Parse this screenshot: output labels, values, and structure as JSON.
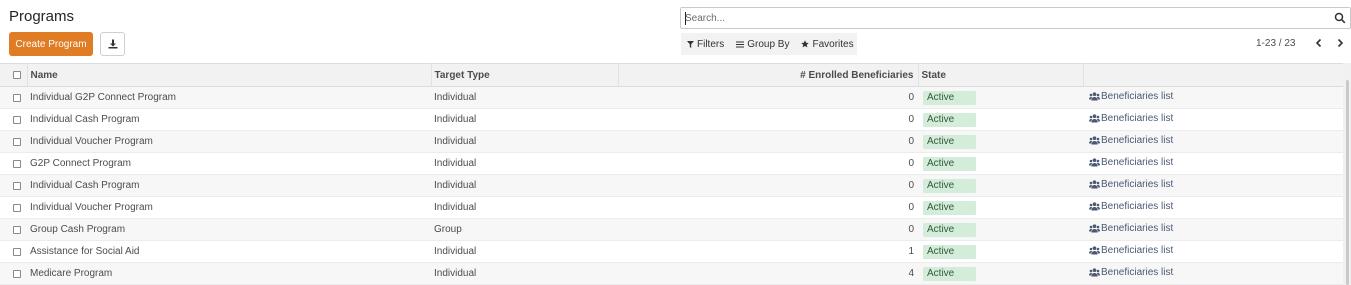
{
  "page": {
    "title": "Programs"
  },
  "toolbar": {
    "create_label": "Create Program",
    "download_icon": "download-icon"
  },
  "search": {
    "placeholder": "Search...",
    "value": ""
  },
  "filters": {
    "filters_label": "Filters",
    "group_by_label": "Group By",
    "favorites_label": "Favorites"
  },
  "pager": {
    "value": "1-23 / 23"
  },
  "table": {
    "headers": {
      "name": "Name",
      "target_type": "Target Type",
      "enrolled": "# Enrolled Beneficiaries",
      "state": "State"
    },
    "rows": [
      {
        "name": "Individual G2P Connect Program",
        "target_type": "Individual",
        "enrolled": "0",
        "state": "Active",
        "action": "Beneficiaries list"
      },
      {
        "name": "Individual Cash Program",
        "target_type": "Individual",
        "enrolled": "0",
        "state": "Active",
        "action": "Beneficiaries list"
      },
      {
        "name": "Individual Voucher Program",
        "target_type": "Individual",
        "enrolled": "0",
        "state": "Active",
        "action": "Beneficiaries list"
      },
      {
        "name": "G2P Connect Program",
        "target_type": "Individual",
        "enrolled": "0",
        "state": "Active",
        "action": "Beneficiaries list"
      },
      {
        "name": "Individual Cash Program",
        "target_type": "Individual",
        "enrolled": "0",
        "state": "Active",
        "action": "Beneficiaries list"
      },
      {
        "name": "Individual Voucher Program",
        "target_type": "Individual",
        "enrolled": "0",
        "state": "Active",
        "action": "Beneficiaries list"
      },
      {
        "name": "Group Cash Program",
        "target_type": "Group",
        "enrolled": "0",
        "state": "Active",
        "action": "Beneficiaries list"
      },
      {
        "name": "Assistance for Social Aid",
        "target_type": "Individual",
        "enrolled": "1",
        "state": "Active",
        "action": "Beneficiaries list"
      },
      {
        "name": "Medicare Program",
        "target_type": "Individual",
        "enrolled": "4",
        "state": "Active",
        "action": "Beneficiaries list"
      }
    ]
  },
  "colors": {
    "primary": "#e07d24",
    "active_badge_bg": "#d4edda",
    "header_bg": "#f2f2f2"
  }
}
